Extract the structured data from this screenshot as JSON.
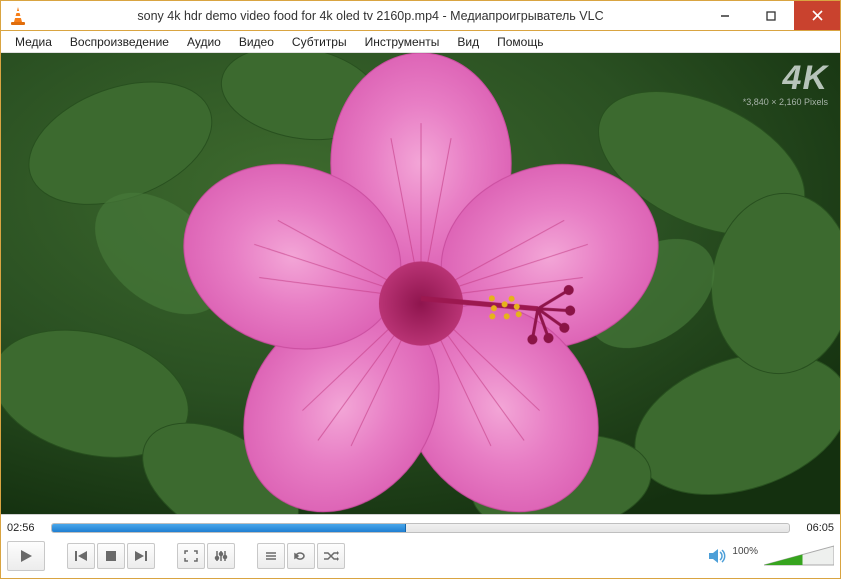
{
  "title": "sony 4k hdr demo video food for 4k oled tv 2160p.mp4 - Медиапроигрыватель VLC",
  "menu": {
    "media": "Медиа",
    "playback": "Воспроизведение",
    "audio": "Аудио",
    "video": "Видео",
    "subtitles": "Субтитры",
    "tools": "Инструменты",
    "view": "Вид",
    "help": "Помощь"
  },
  "overlay": {
    "badge": "4K",
    "resolution": "*3,840 × 2,160 Pixels"
  },
  "time": {
    "current": "02:56",
    "total": "06:05",
    "progress_percent": 48
  },
  "volume": {
    "label": "100%",
    "level_percent": 100,
    "widget_fill_percent": 55
  }
}
